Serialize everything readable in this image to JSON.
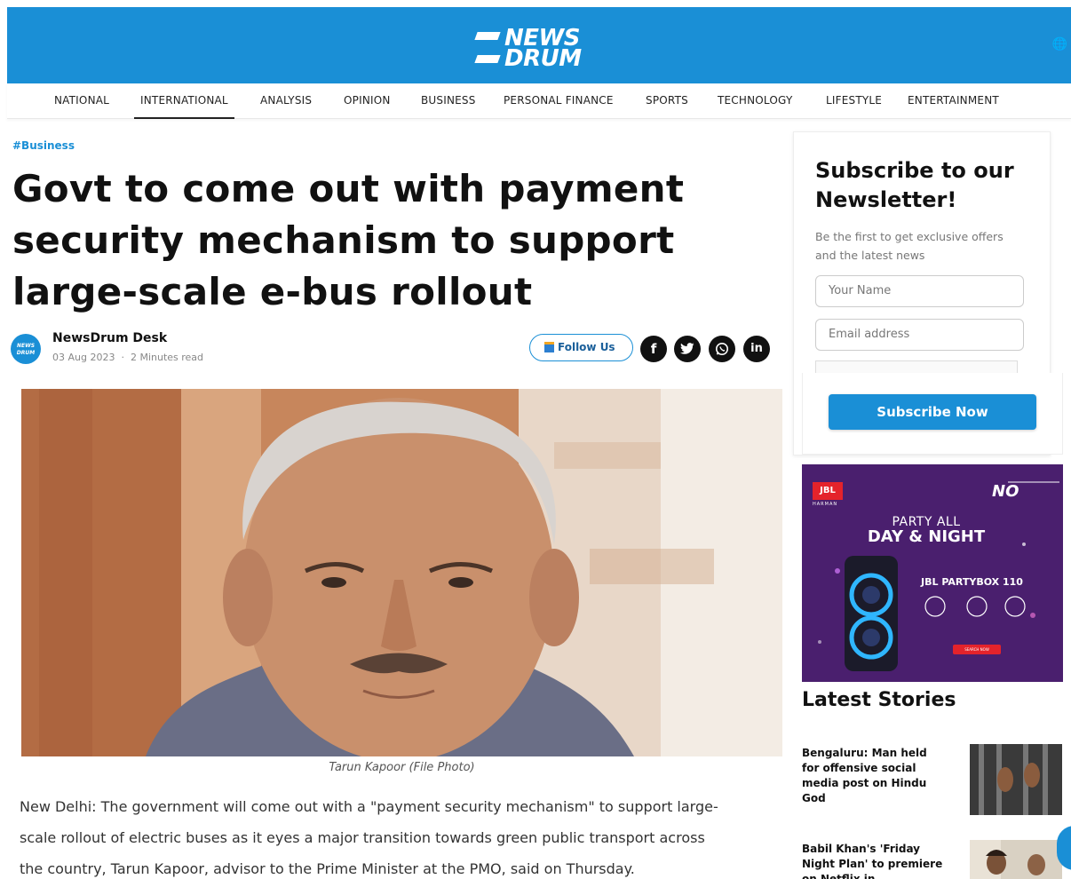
{
  "brand": {
    "logo_line1": "NEWS",
    "logo_line2": "DRUM",
    "globe_icon": "globe-icon",
    "header_color": "#1a8fd6"
  },
  "nav": {
    "items": [
      {
        "label": "NATIONAL"
      },
      {
        "label": "INTERNATIONAL",
        "active": true
      },
      {
        "label": "ANALYSIS"
      },
      {
        "label": "OPINION"
      },
      {
        "label": "BUSINESS"
      },
      {
        "label": "PERSONAL FINANCE"
      },
      {
        "label": "SPORTS"
      },
      {
        "label": "TECHNOLOGY"
      },
      {
        "label": "LIFESTYLE"
      },
      {
        "label": "ENTERTAINMENT"
      }
    ]
  },
  "article": {
    "tag": "#Business",
    "headline_lines": [
      "Govt to come out with payment",
      "security mechanism to support",
      "large-scale e-bus rollout"
    ],
    "author": "NewsDrum Desk",
    "author_logo": "NEWS DRUM",
    "date": "03 Aug 2023",
    "separator": "·",
    "read_time": "2 Minutes read",
    "image_caption": "Tarun Kapoor (File Photo)",
    "body_lines": [
      "New Delhi: The government will come out with a \"payment security mechanism\" to support large-",
      "scale rollout of electric buses as it eyes a major transition towards green public transport across",
      "the country, Tarun Kapoor, advisor to the Prime Minister at the PMO, said on Thursday."
    ]
  },
  "share": {
    "follow_label": "Follow Us",
    "follow_icon": "google-news-icon",
    "icons": [
      {
        "name": "facebook-icon",
        "glyph": "f"
      },
      {
        "name": "twitter-icon",
        "glyph": "t"
      },
      {
        "name": "whatsapp-icon",
        "glyph": "w"
      },
      {
        "name": "linkedin-icon",
        "glyph": "in"
      }
    ]
  },
  "newsletter": {
    "title_line1": "Subscribe to our",
    "title_line2": "Newsletter!",
    "desc_line1": "Be the first to get exclusive offers",
    "desc_line2": "and the latest news",
    "name_placeholder": "Your Name",
    "email_placeholder": "Email address",
    "button_label": "Subscribe Now"
  },
  "ad": {
    "brand": "JBL",
    "brand_sub": "HARMAN",
    "rank": "NO",
    "line1": "PARTY ALL",
    "line2": "DAY & NIGHT",
    "product": "JBL PARTYBOX 110",
    "button_label": "SEARCH NOW",
    "bg_color": "#4a1f6e"
  },
  "latest": {
    "title": "Latest Stories",
    "stories": [
      {
        "lines": [
          "Bengaluru: Man held",
          "for offensive social",
          "media post on Hindu",
          "God"
        ]
      },
      {
        "lines": [
          "Babil Khan's 'Friday",
          "Night Plan' to premiere",
          "on Netflix in"
        ]
      }
    ]
  }
}
